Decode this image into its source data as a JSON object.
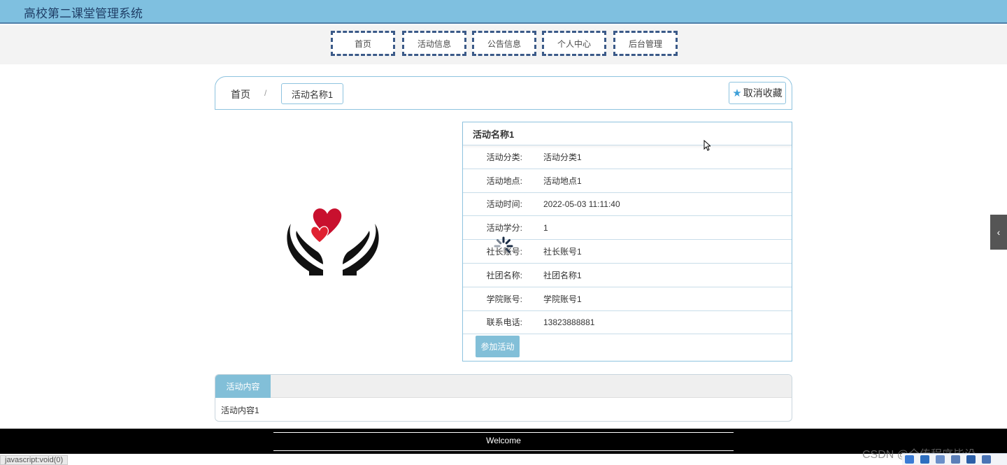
{
  "header": {
    "title": "高校第二课堂管理系统"
  },
  "nav": [
    {
      "label": "首页"
    },
    {
      "label": "活动信息"
    },
    {
      "label": "公告信息"
    },
    {
      "label": "个人中心"
    },
    {
      "label": "后台管理"
    }
  ],
  "breadcrumb": {
    "home": "首页",
    "separator": "/",
    "current": "活动名称1"
  },
  "favorite": {
    "label": "取消收藏"
  },
  "detail": {
    "title": "活动名称1",
    "rows": [
      {
        "label": "活动分类:",
        "value": "活动分类1"
      },
      {
        "label": "活动地点:",
        "value": "活动地点1"
      },
      {
        "label": "活动时间:",
        "value": "2022-05-03 11:11:40"
      },
      {
        "label": "活动学分:",
        "value": "1"
      },
      {
        "label": "社长账号:",
        "value": "社长账号1"
      },
      {
        "label": "社团名称:",
        "value": "社团名称1"
      },
      {
        "label": "学院账号:",
        "value": "学院账号1"
      },
      {
        "label": "联系电话:",
        "value": "13823888881"
      }
    ],
    "join_label": "参加活动"
  },
  "content": {
    "tab": "活动内容",
    "text": "活动内容1"
  },
  "footer": {
    "text": "Welcome"
  },
  "status": {
    "text": "javascript:void(0)"
  },
  "watermark": {
    "text": "CSDN @全传程序毕设"
  },
  "colors": {
    "topbar": "#7fc0e0",
    "accent": "#82bfd8",
    "nav_border": "#3b5a88"
  }
}
